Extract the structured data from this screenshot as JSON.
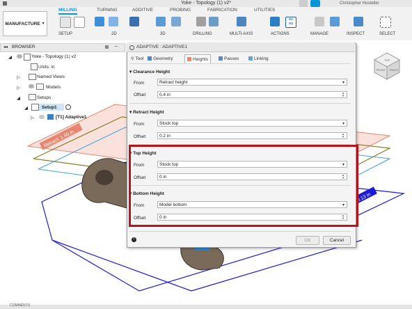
{
  "window": {
    "title": "Yoke - Topology (1) v2*",
    "user": "Christopher Hostetler"
  },
  "ribbon": {
    "workspace": "MANUFACTURE",
    "tabs": [
      "MILLING",
      "TURNING",
      "ADDITIVE",
      "PROBING",
      "FABRICATION",
      "UTILITIES"
    ],
    "groups": [
      "SETUP",
      "2D",
      "3D",
      "DRILLING",
      "MULTI-AXIS",
      "ACTIONS",
      "MANAGE",
      "INSPECT",
      "SELECT"
    ],
    "g1g2": "G1\nG2"
  },
  "browser": {
    "header": "BROWSER",
    "items": [
      "Yoke - Topology (1) v2",
      "Units: in",
      "Named Views",
      "Models",
      "Setups",
      "Setup1",
      "[T1] Adaptive1"
    ]
  },
  "viewcube": {
    "face_front": "FRONT",
    "face_right": "RIGHT",
    "face_top": "TOP"
  },
  "scene": {
    "retract_label": "Retract: 1.45 in",
    "right_label": "0.13 in"
  },
  "dialog": {
    "title": "ADAPTIVE : ADAPTIVE1",
    "tabs": [
      "Tool",
      "Geometry",
      "Heights",
      "Passes",
      "Linking"
    ],
    "sections": [
      {
        "title": "Clearance Height",
        "from": "Retract height",
        "offset": "0.4 in"
      },
      {
        "title": "Retract Height",
        "from": "Stock top",
        "offset": "0.2 in"
      },
      {
        "title": "Top Height",
        "from": "Stock top",
        "offset": "0 in"
      },
      {
        "title": "Bottom Height",
        "from": "Model bottom",
        "offset": "0 in"
      }
    ],
    "from_label": "From",
    "offset_label": "Offset",
    "ok": "OK",
    "cancel": "Cancel",
    "highlight_color": "#b3151b"
  },
  "comments": "COMMENTS",
  "colors": {
    "accent": "#0696d7",
    "plane_red": "#e8856e",
    "plane_olive": "#8a7d2a",
    "plane_blue": "#1a1ad6",
    "plane_cyan": "#3aa0e0"
  }
}
